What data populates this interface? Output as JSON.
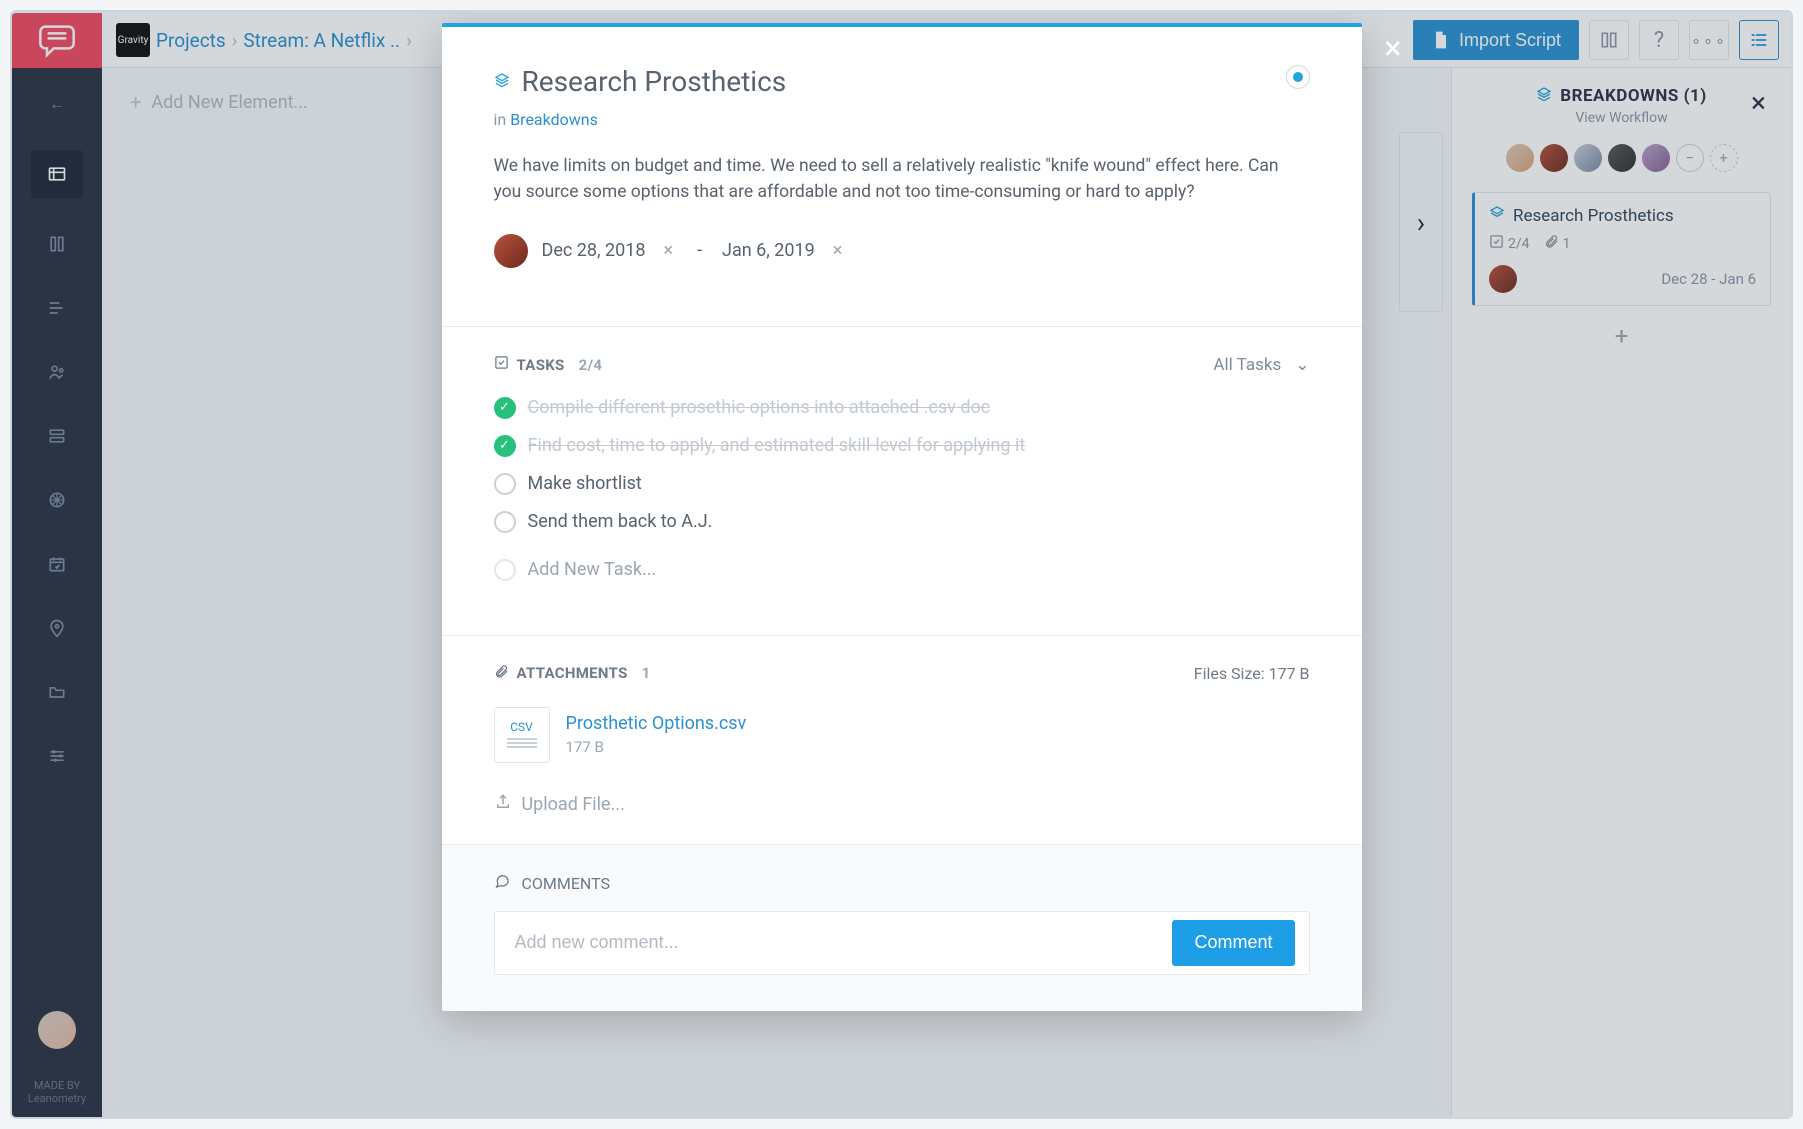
{
  "topbar": {
    "app_name": "Gravity",
    "breadcrumb_projects": "Projects",
    "breadcrumb_stream": "Stream: A Netflix ..",
    "import_label": "Import Script"
  },
  "left_column": {
    "add_element": "Add New Element..."
  },
  "right_panel": {
    "title": "BREAKDOWNS (1)",
    "subtitle": "View Workflow",
    "card": {
      "title": "Research Prosthetics",
      "tasks": "2/4",
      "attachments": "1",
      "dates": "Dec 28 - Jan 6"
    }
  },
  "modal": {
    "title": "Research Prosthetics",
    "in_prefix": "in ",
    "in_link": "Breakdowns",
    "description": "We have limits on budget and time. We need to sell a relatively realistic \"knife wound\" effect here. Can you source some options that are affordable and not too time-consuming or hard to apply?",
    "date_start": "Dec 28, 2018",
    "date_sep": "-",
    "date_end": "Jan 6, 2019",
    "tasks": {
      "title": "TASKS",
      "count": "2/4",
      "filter": "All Tasks",
      "items": [
        {
          "done": true,
          "label": "Compile different prosethic options into attached .csv doc"
        },
        {
          "done": true,
          "label": "Find cost, time to apply, and estimated skill-level for applying it"
        },
        {
          "done": false,
          "label": "Make shortlist"
        },
        {
          "done": false,
          "label": "Send them back to A.J."
        }
      ],
      "add_placeholder": "Add New Task..."
    },
    "attachments": {
      "title": "ATTACHMENTS",
      "count": "1",
      "files_size_label": "Files Size: 177 B",
      "file_name": "Prosthetic Options.csv",
      "file_size": "177 B",
      "file_ext": "CSV",
      "upload_label": "Upload File..."
    },
    "comments": {
      "title": "COMMENTS",
      "placeholder": "Add new comment...",
      "button": "Comment"
    }
  },
  "footer": {
    "made_by": "MADE BY",
    "brand": "Leanometry"
  }
}
